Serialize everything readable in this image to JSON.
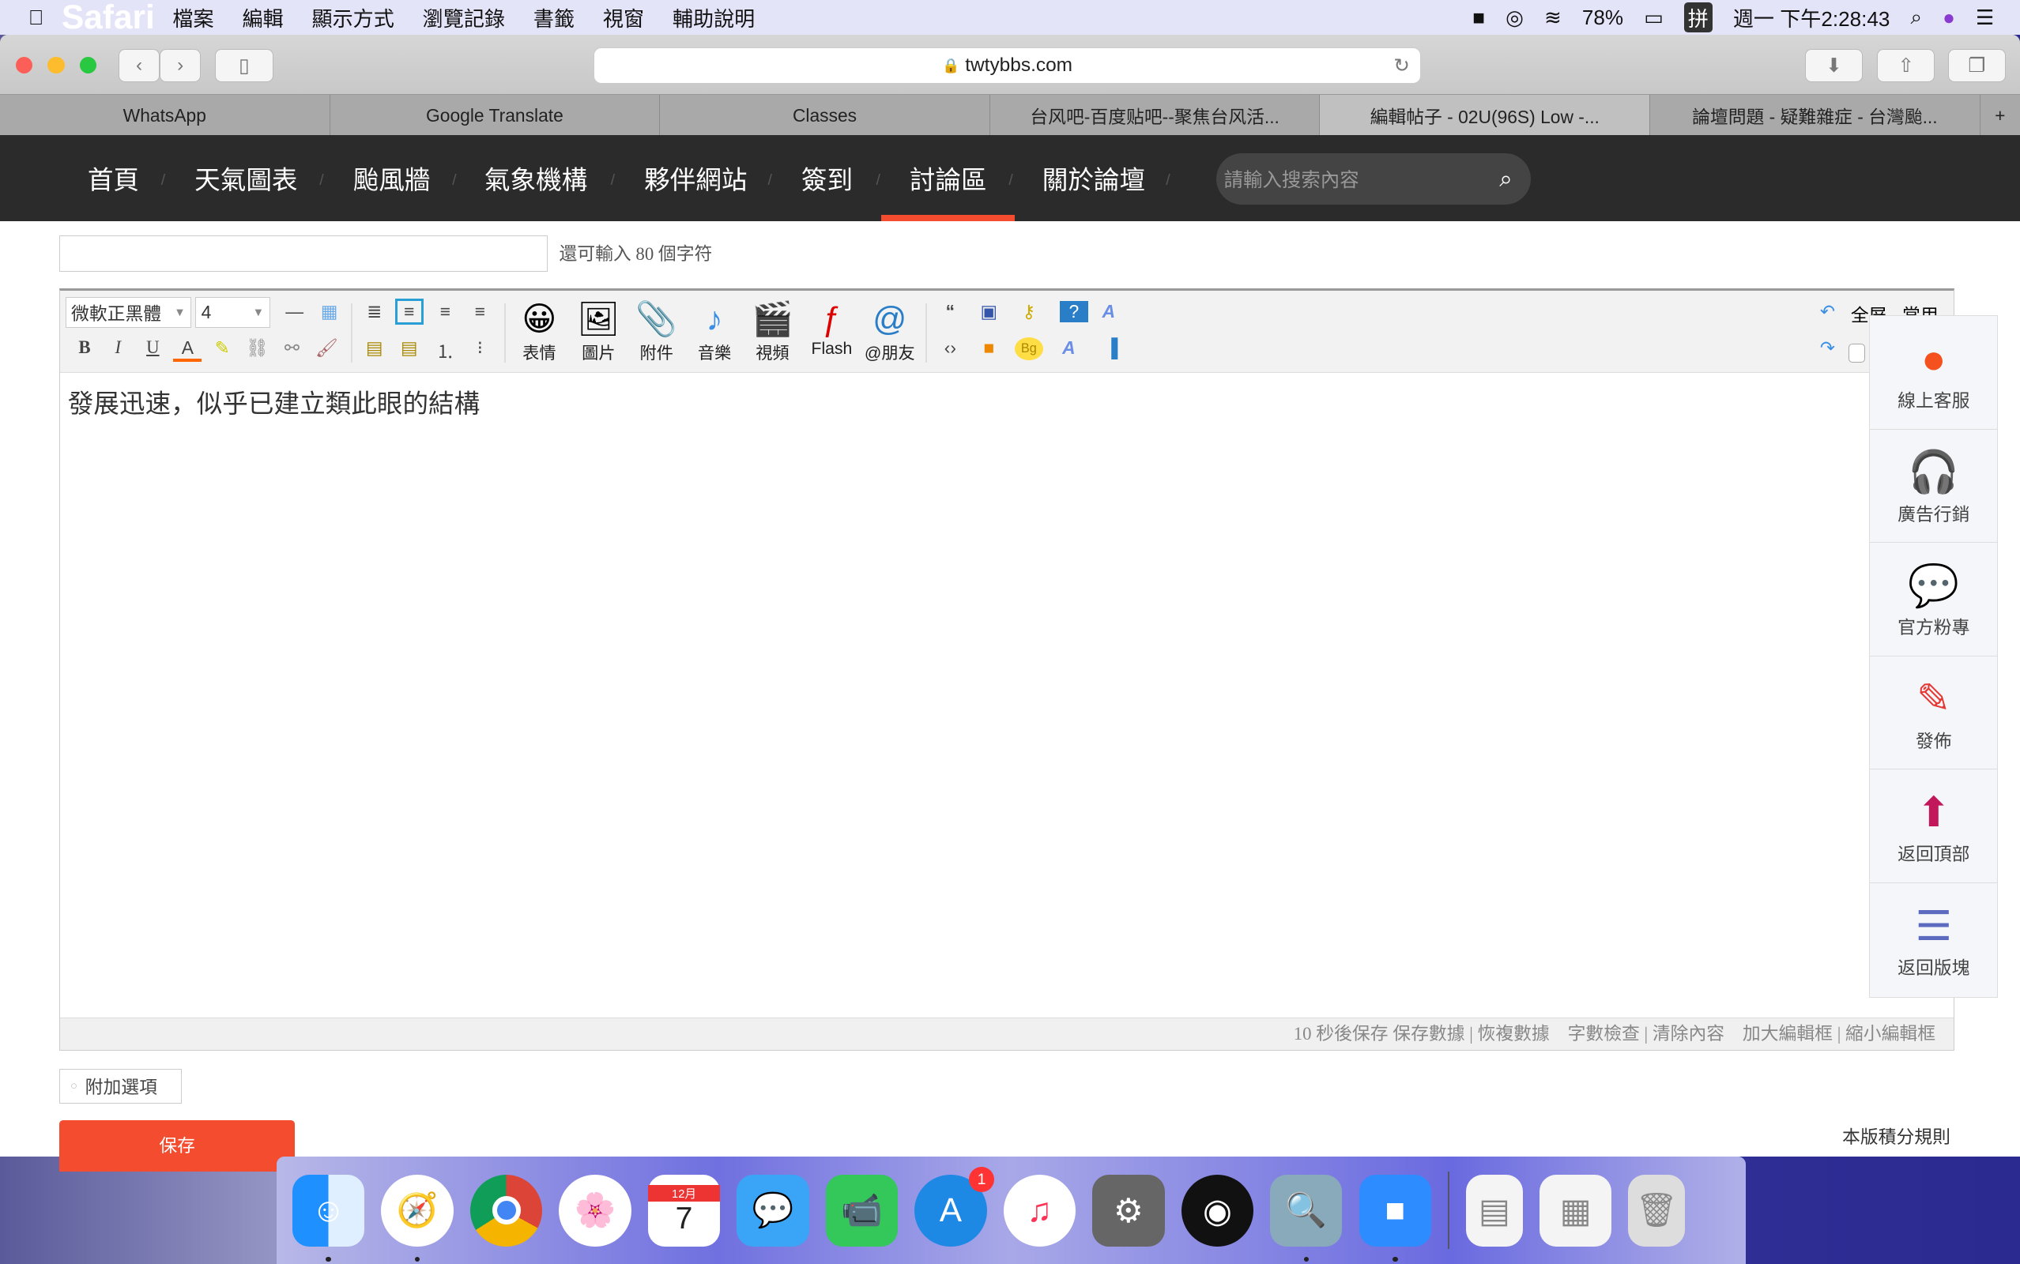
{
  "menubar": {
    "app": "Safari",
    "items": [
      "檔案",
      "編輯",
      "顯示方式",
      "瀏覽記錄",
      "書籤",
      "視窗",
      "輔助說明"
    ],
    "battery": "78%",
    "input_method": "拼",
    "clock": "週一 下午2:28:43"
  },
  "browser": {
    "url": "twtybbs.com",
    "tabs": [
      "WhatsApp",
      "Google Translate",
      "Classes",
      "台风吧-百度贴吧--聚焦台风活...",
      "編輯帖子 - 02U(96S) Low -...",
      "論壇問題 - 疑難雜症 - 台灣颱..."
    ],
    "active_tab": 4
  },
  "site": {
    "nav": [
      "首頁",
      "天氣圖表",
      "颱風牆",
      "氣象機構",
      "夥伴網站",
      "簽到",
      "討論區",
      "關於論壇"
    ],
    "active_nav": 6,
    "search_placeholder": "請輸入搜索內容",
    "accent": "#f44c2e"
  },
  "form": {
    "title_value": "",
    "title_hint": "還可輸入 80 個字符",
    "extra_options": "附加選項",
    "save": "保存",
    "rules_link": "本版積分規則"
  },
  "editor": {
    "font": "微軟正黑體",
    "size": "4",
    "media_buttons": [
      "表情",
      "圖片",
      "附件",
      "音樂",
      "視頻",
      "Flash",
      "@朋友"
    ],
    "right_buttons": [
      "全屏",
      "常用"
    ],
    "body_text": "發展迅速，似乎已建立類此眼的結構",
    "footer": {
      "autosave": "10 秒後保存",
      "save_data": "保存數據",
      "restore": "恢複數據",
      "word_check": "字數檢查",
      "clear": "清除內容",
      "enlarge": "加大編輯框",
      "shrink": "縮小編輯框"
    }
  },
  "side_panel": [
    "線上客服",
    "廣告行銷",
    "官方粉專",
    "發佈",
    "返回頂部",
    "返回版塊"
  ],
  "dock": {
    "apps": [
      "finder",
      "safari",
      "chrome",
      "photos",
      "calendar",
      "messages",
      "facetime",
      "app-store",
      "itunes",
      "system-preferences",
      "obs",
      "preview",
      "zoom",
      "documents",
      "spreadsheet",
      "trash"
    ],
    "calendar_month": "12月",
    "calendar_day": "7",
    "app_store_badge": "1"
  }
}
